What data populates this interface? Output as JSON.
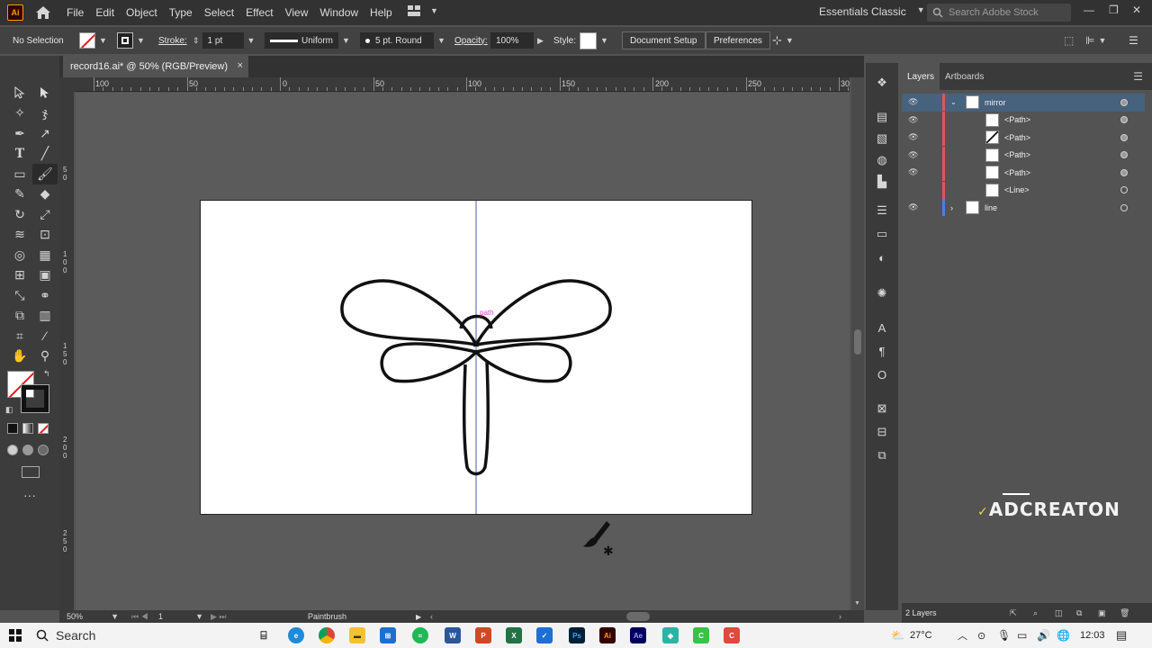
{
  "app": {
    "logo": "Ai",
    "menu": [
      "File",
      "Edit",
      "Object",
      "Type",
      "Select",
      "Effect",
      "View",
      "Window",
      "Help"
    ],
    "workspace": "Essentials Classic",
    "search_placeholder": "Search Adobe Stock"
  },
  "control_bar": {
    "selection": "No Selection",
    "stroke_label": "Stroke:",
    "stroke_weight": "1 pt",
    "profile": "Uniform",
    "brush": "5 pt. Round",
    "opacity_label": "Opacity:",
    "opacity": "100%",
    "style_label": "Style:",
    "document_setup": "Document Setup",
    "preferences": "Preferences"
  },
  "document": {
    "tab_title": "record16.ai* @ 50% (RGB/Preview)",
    "close": "×",
    "path_hint": "path"
  },
  "rulers": {
    "h_labels": [
      "100",
      "50",
      "0",
      "50",
      "100",
      "150",
      "200",
      "250",
      "30"
    ],
    "v_labels": [
      "5\n0",
      "1\n0\n0",
      "1\n5\n0",
      "2\n0\n0",
      "2\n5\n0"
    ]
  },
  "status_bar": {
    "zoom": "50%",
    "artboard": "1",
    "tool": "Paintbrush"
  },
  "layers_panel": {
    "tabs": [
      "Layers",
      "Artboards"
    ],
    "rows": [
      {
        "name": "mirror",
        "kind": "layer",
        "expanded": true,
        "selected": true
      },
      {
        "name": "<Path>",
        "kind": "sub"
      },
      {
        "name": "<Path>",
        "kind": "sub"
      },
      {
        "name": "<Path>",
        "kind": "sub"
      },
      {
        "name": "<Path>",
        "kind": "sub"
      },
      {
        "name": "<Line>",
        "kind": "sub"
      },
      {
        "name": "line",
        "kind": "layer",
        "expanded": false
      }
    ],
    "footer": "2 Layers",
    "layer_color_mirror": "#e0555a",
    "layer_color_line": "#4a7fe0"
  },
  "watermark": "ADCREATON",
  "taskbar": {
    "search": "Search",
    "apps": [
      "Ps",
      "Ai",
      "Ae"
    ],
    "temperature": "27°C",
    "time": "12:03"
  }
}
